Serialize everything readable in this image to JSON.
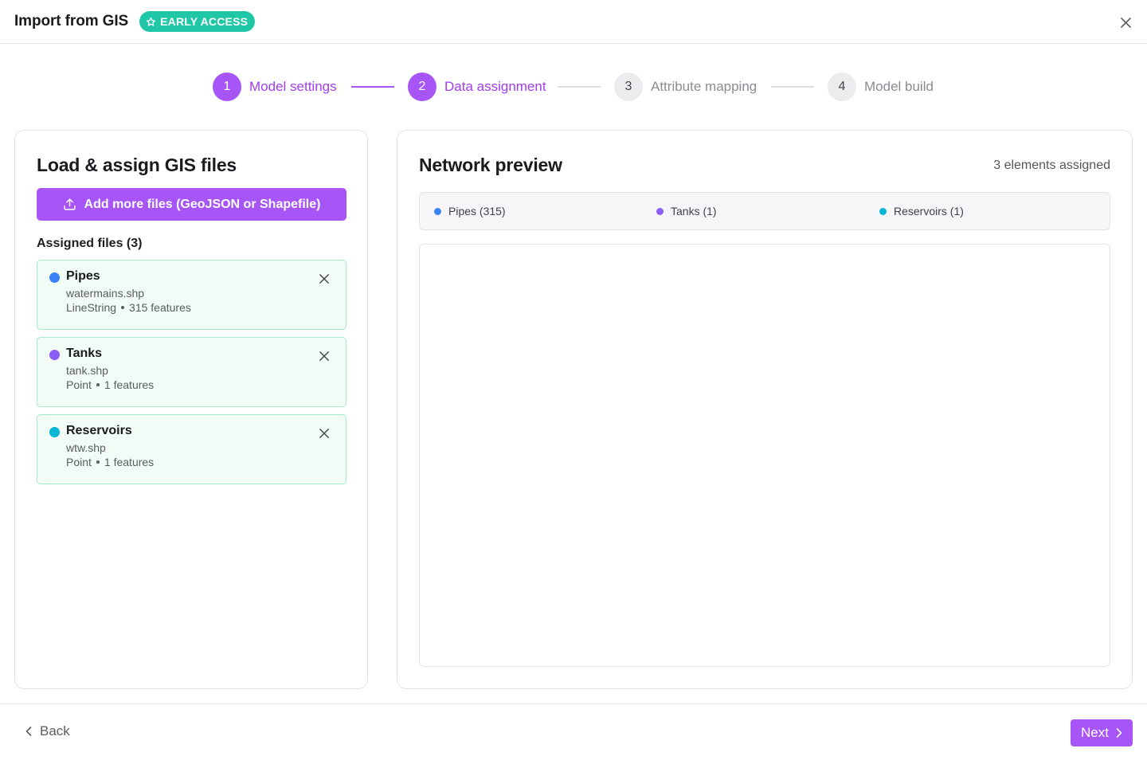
{
  "header": {
    "title": "Import from GIS",
    "badge": "EARLY ACCESS",
    "badge_icon": "star-icon",
    "close_icon": "close-icon"
  },
  "stepper": {
    "steps": [
      {
        "number": "1",
        "label": "Model settings",
        "state": "complete"
      },
      {
        "number": "2",
        "label": "Data assignment",
        "state": "active"
      },
      {
        "number": "3",
        "label": "Attribute mapping",
        "state": "pending"
      },
      {
        "number": "4",
        "label": "Model build",
        "state": "pending"
      }
    ]
  },
  "left_panel": {
    "title": "Load & assign GIS files",
    "add_button": "Add more files (GeoJSON or Shapefile)",
    "add_icon": "upload-icon",
    "assigned_heading": "Assigned files (3)",
    "files": [
      {
        "name": "Pipes",
        "file": "watermains.shp",
        "geometry": "LineString",
        "features": "315 features",
        "color": "#3b82f6"
      },
      {
        "name": "Tanks",
        "file": "tank.shp",
        "geometry": "Point",
        "features": "1 features",
        "color": "#8b5cf6"
      },
      {
        "name": "Reservoirs",
        "file": "wtw.shp",
        "geometry": "Point",
        "features": "1 features",
        "color": "#06b6d4"
      }
    ]
  },
  "right_panel": {
    "title": "Network preview",
    "elements_assigned": "3 elements assigned",
    "legend": [
      {
        "label": "Pipes (315)",
        "color": "#3b82f6"
      },
      {
        "label": "Tanks (1)",
        "color": "#8b5cf6"
      },
      {
        "label": "Reservoirs (1)",
        "color": "#06b6d4"
      }
    ]
  },
  "footer": {
    "back_label": "Back",
    "next_label": "Next"
  },
  "colors": {
    "accent": "#a855f7",
    "badge": "#1fc7a6",
    "card_border": "#a7ebc6",
    "card_bg": "#f0fcf5"
  }
}
